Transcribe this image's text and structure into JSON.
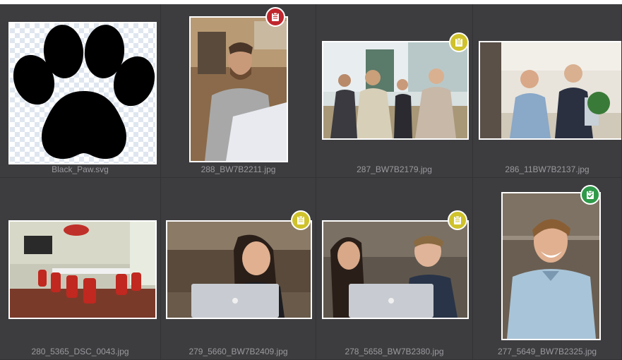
{
  "colors": {
    "background": "#3b3b3d",
    "caption": "#9a9a9e",
    "badge_red": "#c0262d",
    "badge_yellow": "#cfc22c",
    "badge_green": "#2f9a4a"
  },
  "tiles": [
    {
      "filename": "Black_Paw.svg",
      "badge": null,
      "image": "black-paw-print"
    },
    {
      "filename": "288_BW7B2211.jpg",
      "badge": {
        "status": "red",
        "icon": "clipboard-icon"
      },
      "image": "bearded-man-laptop"
    },
    {
      "filename": "287_BW7B2179.jpg",
      "badge": {
        "status": "yellow",
        "icon": "clipboard-icon"
      },
      "image": "meeting-table-group"
    },
    {
      "filename": "286_11BW7B2137.jpg",
      "badge": null,
      "image": "men-at-table-plant"
    },
    {
      "filename": "280_5365_DSC_0043.jpg",
      "badge": null,
      "image": "conference-room-red-chairs"
    },
    {
      "filename": "279_5660_BW7B2409.jpg",
      "badge": {
        "status": "yellow",
        "icon": "clipboard-icon"
      },
      "image": "woman-laptop-smiling"
    },
    {
      "filename": "278_5658_BW7B2380.jpg",
      "badge": {
        "status": "yellow",
        "icon": "clipboard-icon"
      },
      "image": "woman-man-laptop"
    },
    {
      "filename": "277_5649_BW7B2325.jpg",
      "badge": {
        "status": "green",
        "icon": "clipboard-check-icon"
      },
      "image": "smiling-man-portrait"
    }
  ]
}
